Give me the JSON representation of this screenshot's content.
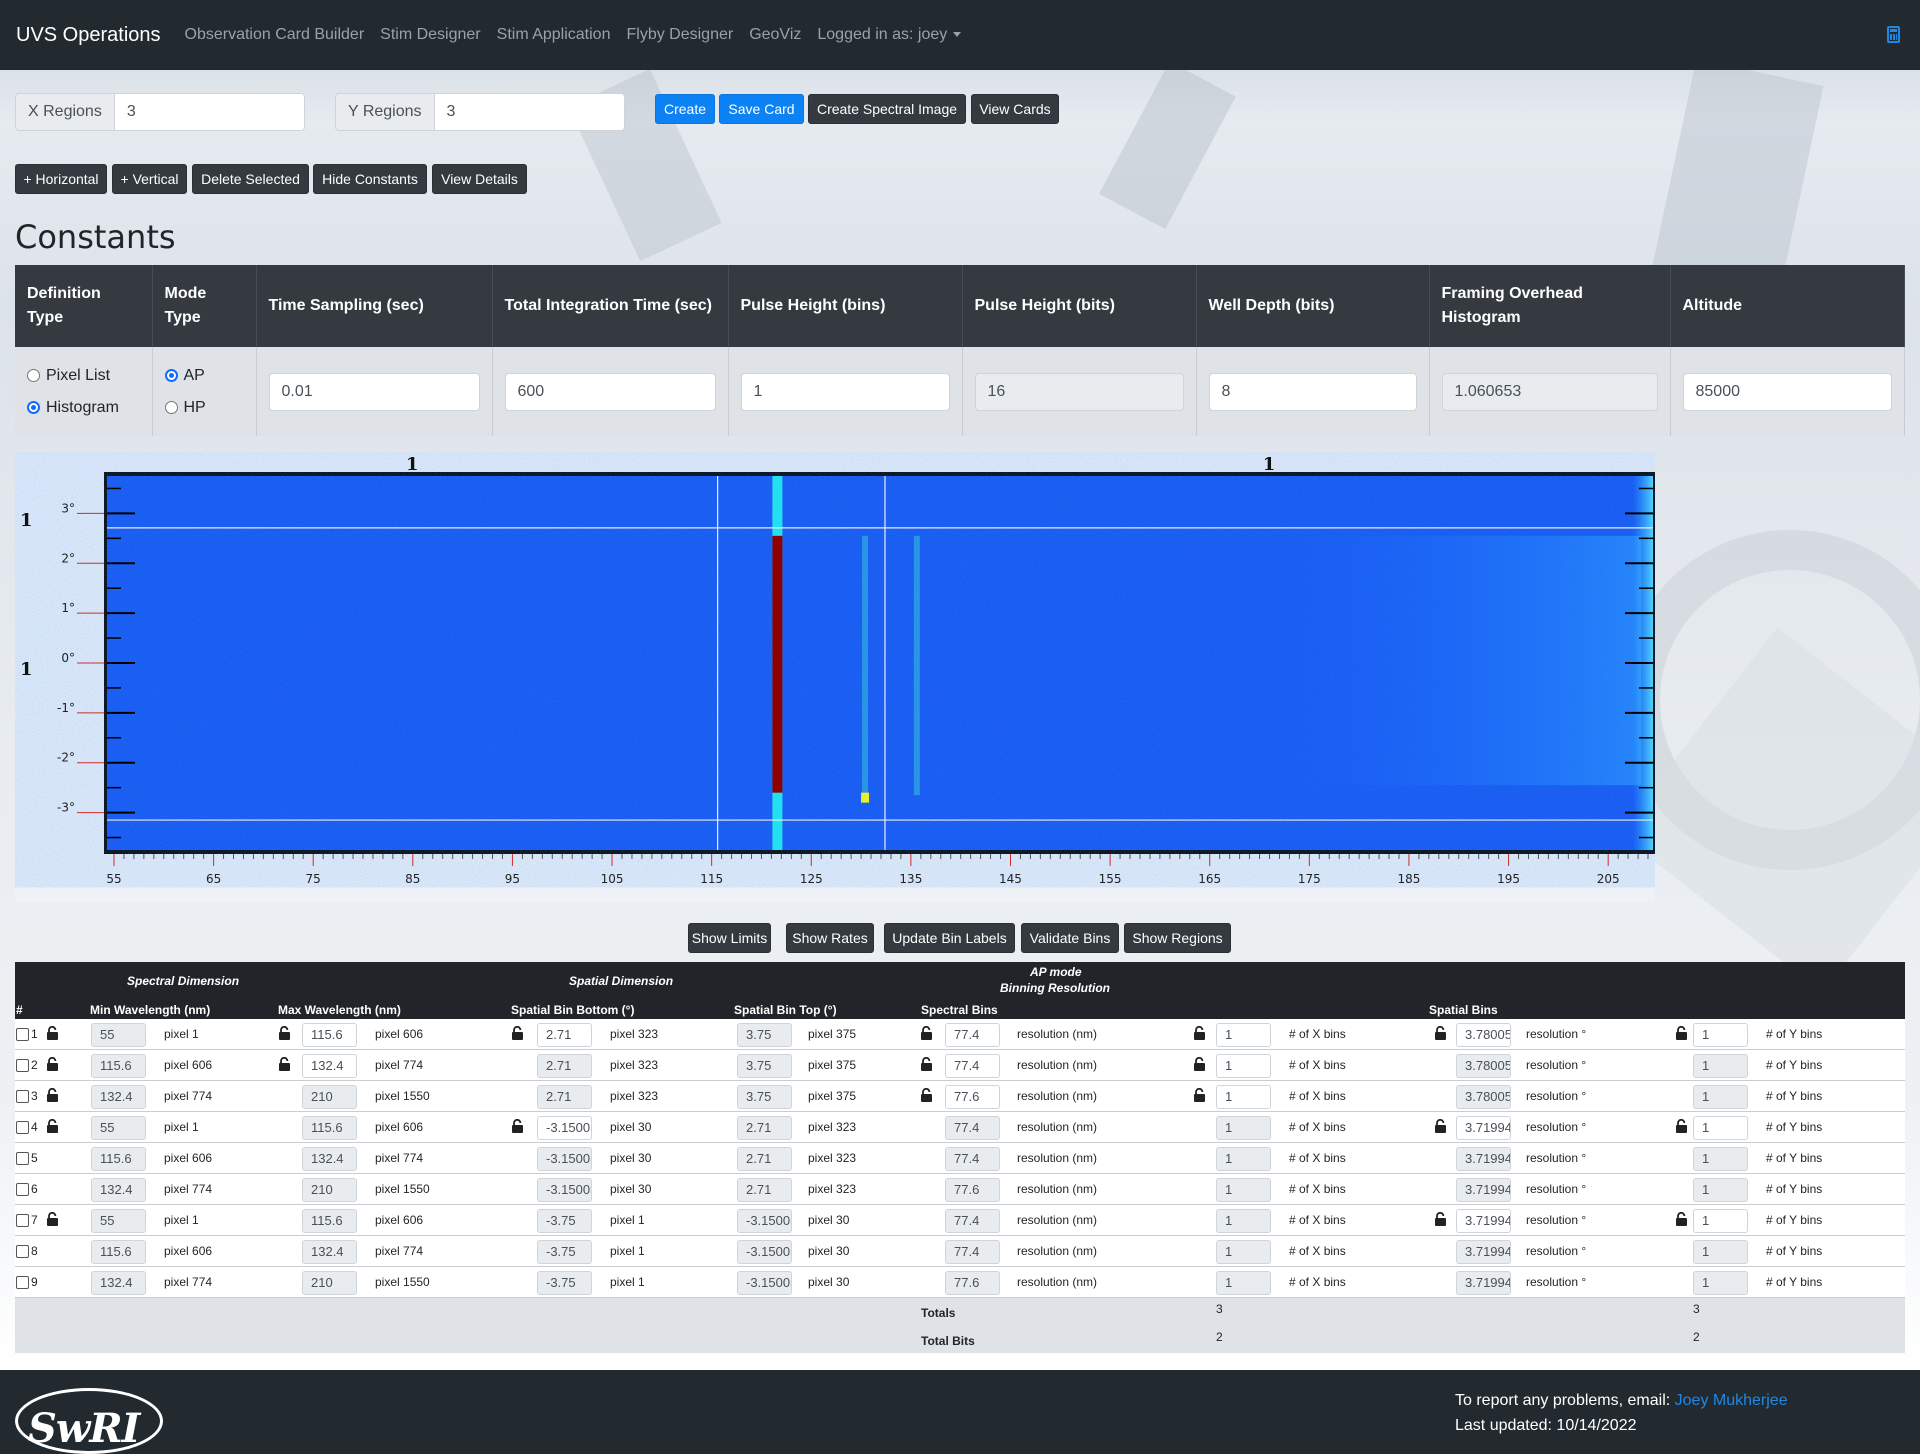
{
  "navbar": {
    "brand": "UVS Operations",
    "links": [
      "Observation Card Builder",
      "Stim Designer",
      "Stim Application",
      "Flyby Designer",
      "GeoViz"
    ],
    "user": "Logged in as: joey",
    "calc_icon": "calculator-icon"
  },
  "regions": {
    "x_label": "X Regions",
    "x_value": "3",
    "y_label": "Y Regions",
    "y_value": "3"
  },
  "toolbar": {
    "create": "Create",
    "save_card": "Save Card",
    "create_spectral": "Create Spectral Image",
    "view_cards": "View Cards",
    "add_horizontal": "+ Horizontal",
    "add_vertical": "+ Vertical",
    "delete_selected": "Delete Selected",
    "hide_constants": "Hide Constants",
    "view_details": "View Details"
  },
  "constants": {
    "title": "Constants",
    "headers": [
      "Definition Type",
      "Mode Type",
      "Time Sampling (sec)",
      "Total Integration Time (sec)",
      "Pulse Height (bins)",
      "Pulse Height (bits)",
      "Well Depth (bits)",
      "Framing Overhead Histogram",
      "Altitude"
    ],
    "definition_options": [
      "Pixel List",
      "Histogram"
    ],
    "definition_selected": "Histogram",
    "mode_options": [
      "AP",
      "HP"
    ],
    "mode_selected": "AP",
    "time_sampling": "0.01",
    "total_integration": "600",
    "pulse_height_bins": "1",
    "pulse_height_bits": "16",
    "well_depth": "8",
    "framing_overhead": "1.060653",
    "altitude": "85000"
  },
  "chart_data": {
    "type": "heatmap",
    "x_ticks": [
      "55",
      "65",
      "75",
      "85",
      "95",
      "105",
      "115",
      "125",
      "135",
      "145",
      "155",
      "165",
      "175",
      "185",
      "195",
      "205"
    ],
    "y_ticks": [
      "3°",
      "2°",
      "1°",
      "0°",
      "-1°",
      "-2°",
      "-3°"
    ],
    "column_labels": [
      "1",
      "1"
    ],
    "row_labels": [
      "1",
      "1"
    ],
    "xlim": [
      54.3,
      209.5
    ],
    "ylim": [
      -3.75,
      3.75
    ],
    "vertical_dividers": [
      115.6,
      132.4
    ],
    "horizontal_dividers": [
      2.71,
      -3.15
    ],
    "bright_lines": [
      {
        "x": 121.6,
        "color": "#8b0000"
      },
      {
        "x": 130.4,
        "color": "#2fa8e0"
      },
      {
        "x": 135.6,
        "color": "#2fa8e0"
      }
    ]
  },
  "table_buttons": {
    "show_limits": "Show Limits",
    "show_rates": "Show Rates",
    "update_bin_labels": "Update Bin Labels",
    "validate_bins": "Validate Bins",
    "show_regions": "Show Regions"
  },
  "bins": {
    "group_headers": {
      "spectral": "Spectral Dimension",
      "spatial": "Spatial Dimension",
      "mode": "AP mode",
      "binning": "Binning Resolution"
    },
    "headers": {
      "num": "#",
      "min_wl": "Min Wavelength (nm)",
      "max_wl": "Max Wavelength (nm)",
      "sp_bottom": "Spatial Bin Bottom (°)",
      "sp_top": "Spatial Bin Top (°)",
      "spectral_bins": "Spectral Bins",
      "spatial_bins": "Spatial Bins"
    },
    "labels": {
      "res_nm": "resolution (nm)",
      "x_bins": "# of X bins",
      "res_deg": "resolution °",
      "y_bins": "# of Y bins"
    },
    "rows": [
      {
        "n": "1",
        "min": "55",
        "minp": "pixel 1",
        "max": "115.6",
        "maxp": "pixel 606",
        "bot": "2.71",
        "botp": "pixel 323",
        "top": "3.75",
        "topp": "pixel 375",
        "sres": "77.4",
        "xb": "1",
        "pres": "3.78005",
        "yb": "1",
        "locks": [
          1,
          1,
          1,
          0,
          1,
          1,
          1,
          1
        ]
      },
      {
        "n": "2",
        "min": "115.6",
        "minp": "pixel 606",
        "max": "132.4",
        "maxp": "pixel 774",
        "bot": "2.71",
        "botp": "pixel 323",
        "top": "3.75",
        "topp": "pixel 375",
        "sres": "77.4",
        "xb": "1",
        "pres": "3.78005",
        "yb": "1",
        "locks": [
          1,
          1,
          0,
          0,
          1,
          1,
          0,
          0
        ]
      },
      {
        "n": "3",
        "min": "132.4",
        "minp": "pixel 774",
        "max": "210",
        "maxp": "pixel 1550",
        "bot": "2.71",
        "botp": "pixel 323",
        "top": "3.75",
        "topp": "pixel 375",
        "sres": "77.6",
        "xb": "1",
        "pres": "3.78005",
        "yb": "1",
        "locks": [
          1,
          0,
          0,
          0,
          1,
          1,
          0,
          0
        ]
      },
      {
        "n": "4",
        "min": "55",
        "minp": "pixel 1",
        "max": "115.6",
        "maxp": "pixel 606",
        "bot": "-3.15005",
        "botp": "pixel 30",
        "top": "2.71",
        "topp": "pixel 323",
        "sres": "77.4",
        "xb": "1",
        "pres": "3.71994",
        "yb": "1",
        "locks": [
          1,
          0,
          1,
          0,
          0,
          0,
          1,
          1
        ]
      },
      {
        "n": "5",
        "min": "115.6",
        "minp": "pixel 606",
        "max": "132.4",
        "maxp": "pixel 774",
        "bot": "-3.15005",
        "botp": "pixel 30",
        "top": "2.71",
        "topp": "pixel 323",
        "sres": "77.4",
        "xb": "1",
        "pres": "3.71994",
        "yb": "1",
        "locks": [
          0,
          0,
          0,
          0,
          0,
          0,
          0,
          0
        ]
      },
      {
        "n": "6",
        "min": "132.4",
        "minp": "pixel 774",
        "max": "210",
        "maxp": "pixel 1550",
        "bot": "-3.15005",
        "botp": "pixel 30",
        "top": "2.71",
        "topp": "pixel 323",
        "sres": "77.6",
        "xb": "1",
        "pres": "3.71994",
        "yb": "1",
        "locks": [
          0,
          0,
          0,
          0,
          0,
          0,
          0,
          0
        ]
      },
      {
        "n": "7",
        "min": "55",
        "minp": "pixel 1",
        "max": "115.6",
        "maxp": "pixel 606",
        "bot": "-3.75",
        "botp": "pixel 1",
        "top": "-3.15005",
        "topp": "pixel 30",
        "sres": "77.4",
        "xb": "1",
        "pres": "3.71994",
        "yb": "1",
        "locks": [
          1,
          0,
          0,
          0,
          0,
          0,
          1,
          1
        ]
      },
      {
        "n": "8",
        "min": "115.6",
        "minp": "pixel 606",
        "max": "132.4",
        "maxp": "pixel 774",
        "bot": "-3.75",
        "botp": "pixel 1",
        "top": "-3.15005",
        "topp": "pixel 30",
        "sres": "77.4",
        "xb": "1",
        "pres": "3.71994",
        "yb": "1",
        "locks": [
          0,
          0,
          0,
          0,
          0,
          0,
          0,
          0
        ]
      },
      {
        "n": "9",
        "min": "132.4",
        "minp": "pixel 774",
        "max": "210",
        "maxp": "pixel 1550",
        "bot": "-3.75",
        "botp": "pixel 1",
        "top": "-3.15005",
        "topp": "pixel 30",
        "sres": "77.6",
        "xb": "1",
        "pres": "3.71994",
        "yb": "1",
        "locks": [
          0,
          0,
          0,
          0,
          0,
          0,
          0,
          0
        ]
      }
    ],
    "totals_label": "Totals",
    "total_x": "3",
    "total_y": "3",
    "total_bits_label": "Total Bits",
    "bits_x": "2",
    "bits_y": "2"
  },
  "footer": {
    "report": "To report any problems, email:",
    "contact": "Joey Mukherjee",
    "updated": "Last updated: 10/14/2022",
    "logo": "SwRI"
  }
}
